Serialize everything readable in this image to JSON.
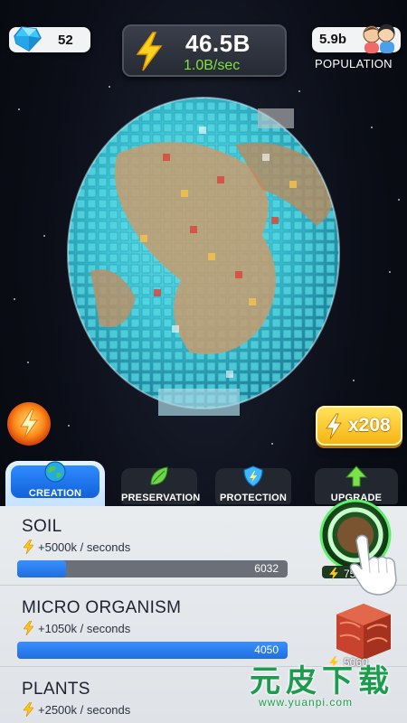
{
  "hud": {
    "gems": "52",
    "energy_total": "46.5B",
    "energy_rate": "1.0B/sec",
    "population_value": "5.9b",
    "population_label": "POPULATION"
  },
  "boost": {
    "label": "x208"
  },
  "tabs": [
    {
      "label": "CREATION",
      "icon": "globe-icon",
      "active": true
    },
    {
      "label": "PRESERVATION",
      "icon": "leaf-icon",
      "active": false
    },
    {
      "label": "PROTECTION",
      "icon": "shield-icon",
      "active": false
    },
    {
      "label": "UPGRADE",
      "icon": "arrow-up-icon",
      "active": false
    }
  ],
  "items": [
    {
      "name": "SOIL",
      "rate": "+5000k / seconds",
      "progress_value": "6032",
      "progress_fraction": 0.18,
      "cost": "75"
    },
    {
      "name": "MICRO ORGANISM",
      "rate": "+1050k / seconds",
      "progress_value": "4050",
      "progress_fraction": 1.0,
      "cost": "5060"
    },
    {
      "name": "PLANTS",
      "rate": "+2500k / seconds",
      "progress_value": "",
      "progress_fraction": 0.0,
      "cost": ""
    }
  ],
  "watermark": {
    "text": "元皮下载",
    "url": "www.yuanpi.com"
  },
  "colors": {
    "accent_blue": "#1f6fe0",
    "energy_green": "#7ee33d",
    "boost_yellow": "#f5b514",
    "panel_bg": "#e6e9ec"
  }
}
